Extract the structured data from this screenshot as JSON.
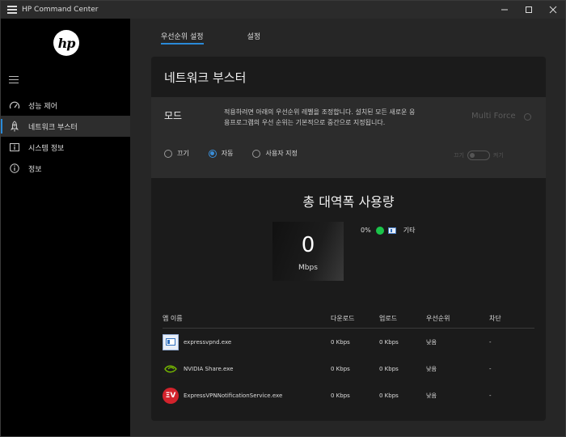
{
  "window": {
    "title": "HP Command Center"
  },
  "sidebar": {
    "items": [
      {
        "label": "성능 제어",
        "icon": "speedometer-icon",
        "active": false
      },
      {
        "label": "네트워크 부스터",
        "icon": "rocket-icon",
        "active": true
      },
      {
        "label": "시스템 정보",
        "icon": "info-box-icon",
        "active": false
      },
      {
        "label": "정보",
        "icon": "info-circle-icon",
        "active": false
      }
    ]
  },
  "tabs": [
    {
      "label": "우선순위 설정",
      "active": true
    },
    {
      "label": "설정",
      "active": false
    }
  ],
  "card": {
    "title": "네트워크 부스터",
    "mode": {
      "label": "모드",
      "description": "적용하려면 아래의 우선순위 레벨을 조정합니다. 설치된 모든 새로운 응용프로그램의 우선 순위는 기본적으로 중간으로 지정됩니다.",
      "multi_force": "Multi Force",
      "options": [
        {
          "label": "끄기",
          "checked": false
        },
        {
          "label": "자동",
          "checked": true
        },
        {
          "label": "사용자 지정",
          "checked": false
        }
      ],
      "toggle_off": "끄기",
      "toggle_on": "켜기"
    },
    "bandwidth": {
      "title": "총 대역폭 사용량",
      "value": "0",
      "unit": "Mbps",
      "legend_percent": "0%",
      "legend_label": "기타",
      "legend_color": "#1bc44a"
    },
    "table": {
      "headers": {
        "name": "앱 이름",
        "download": "다운로드",
        "upload": "업로드",
        "priority": "우선순위",
        "block": "차단"
      },
      "rows": [
        {
          "name": "expressvpnd.exe",
          "icon": "expressvpn-window-icon",
          "download": "0 Kbps",
          "upload": "0 Kbps",
          "priority": "낮음",
          "block": "-"
        },
        {
          "name": "NVIDIA Share.exe",
          "icon": "nvidia-icon",
          "download": "0 Kbps",
          "upload": "0 Kbps",
          "priority": "낮음",
          "block": "-"
        },
        {
          "name": "ExpressVPNNotificationService.exe",
          "icon": "expressvpn-logo-icon",
          "download": "0 Kbps",
          "upload": "0 Kbps",
          "priority": "낮음",
          "block": "-"
        }
      ]
    }
  }
}
